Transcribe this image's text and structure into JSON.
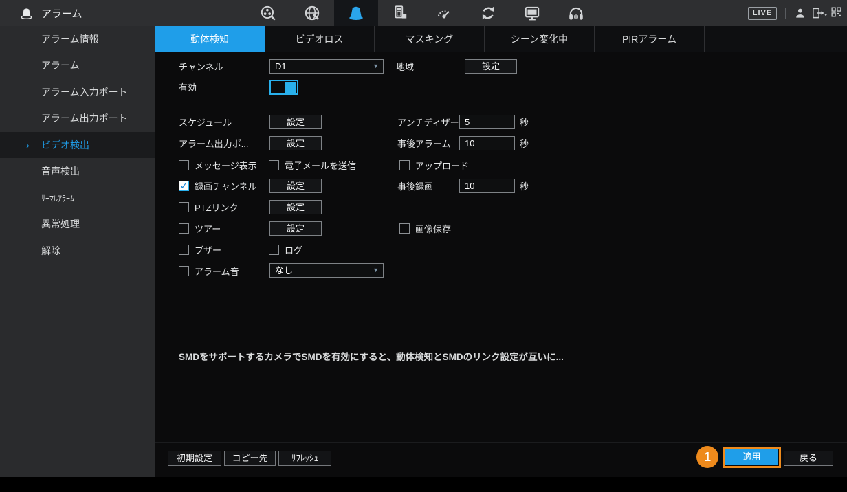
{
  "header": {
    "title": "アラーム",
    "live_badge": "LIVE",
    "nav_icons": [
      "playback-search-icon",
      "network-icon",
      "alarm-icon",
      "storage-icon",
      "performance-gauge-icon",
      "maintenance-refresh-icon",
      "display-icon",
      "audio-headset-icon"
    ],
    "right_icons": [
      "user-icon",
      "logout-icon",
      "qr-code-icon"
    ],
    "active_nav": "alarm-icon"
  },
  "sidebar": {
    "items": [
      {
        "label": "アラーム情報",
        "selected": false
      },
      {
        "label": "アラーム",
        "selected": false
      },
      {
        "label": "アラーム入力ポート",
        "selected": false
      },
      {
        "label": "アラーム出力ポート",
        "selected": false
      },
      {
        "label": "ビデオ検出",
        "selected": true
      },
      {
        "label": "音声検出",
        "selected": false
      },
      {
        "label": "ｻｰﾏﾙｱﾗｰﾑ",
        "selected": false
      },
      {
        "label": "異常処理",
        "selected": false
      },
      {
        "label": "解除",
        "selected": false
      }
    ]
  },
  "tabs": [
    {
      "label": "動体検知",
      "active": true
    },
    {
      "label": "ビデオロス",
      "active": false
    },
    {
      "label": "マスキング",
      "active": false
    },
    {
      "label": "シーン変化中",
      "active": false
    },
    {
      "label": "PIRアラーム",
      "active": false
    }
  ],
  "form": {
    "channel": {
      "label": "チャンネル",
      "value": "D1"
    },
    "region": {
      "label": "地域",
      "button": "設定"
    },
    "enable": {
      "label": "有効",
      "on": true
    },
    "schedule": {
      "label": "スケジュール",
      "button": "設定"
    },
    "anti_dither": {
      "label": "アンチディザー",
      "value": "5",
      "unit": "秒"
    },
    "alarm_out": {
      "label": "アラーム出力ポ...",
      "button": "設定"
    },
    "post_alarm": {
      "label": "事後アラーム",
      "value": "10",
      "unit": "秒"
    },
    "show_message": {
      "label": "メッセージ表示",
      "checked": false
    },
    "send_email": {
      "label": "電子メールを送信",
      "checked": false
    },
    "upload": {
      "label": "アップロード",
      "checked": false
    },
    "record_channel": {
      "label": "録画チャンネル",
      "checked": true,
      "button": "設定"
    },
    "post_record": {
      "label": "事後録画",
      "value": "10",
      "unit": "秒"
    },
    "ptz_link": {
      "label": "PTZリンク",
      "checked": false,
      "button": "設定"
    },
    "tour": {
      "label": "ツアー",
      "checked": false,
      "button": "設定"
    },
    "snapshot": {
      "label": "画像保存",
      "checked": false
    },
    "buzzer": {
      "label": "ブザー",
      "checked": false
    },
    "log": {
      "label": "ログ",
      "checked": false
    },
    "alarm_tone": {
      "label": "アラーム音",
      "checked": false,
      "value": "なし"
    },
    "note": "SMDをサポートするカメラでSMDを有効にすると、動体検知とSMDのリンク設定が互いに..."
  },
  "footer": {
    "default_button": "初期設定",
    "copy_button": "コピー先",
    "refresh_button": "ﾘﾌﾚｯｼｭ",
    "apply_button": "適用",
    "back_button": "戻る",
    "annotation_badge": "1"
  },
  "colors": {
    "accent_blue": "#1f9ee9",
    "toggle_blue": "#29b0ec",
    "annotation_orange": "#ee8a1c",
    "topbar_bg": "#2e2f31",
    "sidebar_bg": "#2a2b2d",
    "content_bg": "#0b0b0c"
  }
}
